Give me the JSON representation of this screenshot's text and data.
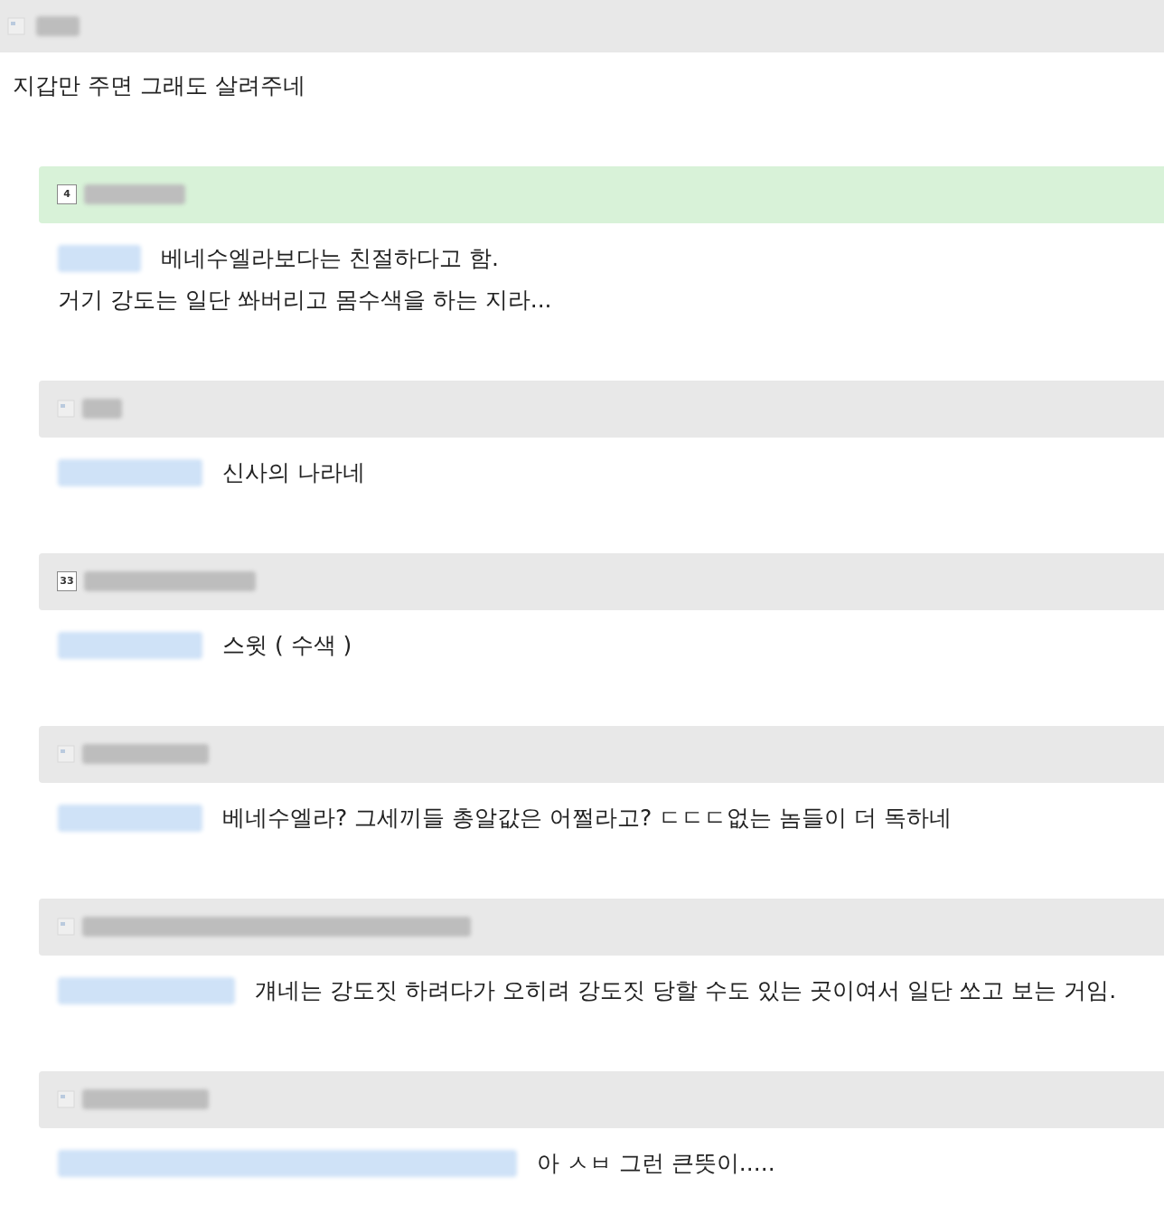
{
  "post": {
    "body": "지갑만 주면 그래도 살려주네"
  },
  "comments": [
    {
      "highlighted": true,
      "badge": "4",
      "reply": [
        "베네수엘라보다는 친절하다고 함.",
        "거기 강도는 일단 쏴버리고 몸수색을 하는 지라..."
      ]
    },
    {
      "highlighted": false,
      "reply": [
        "신사의 나라네"
      ]
    },
    {
      "highlighted": false,
      "badge": "33",
      "reply": [
        "스윗 ( 수색 )"
      ]
    },
    {
      "highlighted": false,
      "reply": [
        "베네수엘라? 그세끼들 총알값은 어쩔라고? ㄷㄷㄷ없는 놈들이 더 독하네"
      ]
    },
    {
      "highlighted": false,
      "reply": [
        "걔네는 강도짓 하려다가 오히려 강도짓 당할 수도 있는 곳이여서 일단 쏘고 보는 거임."
      ]
    },
    {
      "highlighted": false,
      "reply": [
        "아 ㅅㅂ 그런 큰뜻이....."
      ]
    }
  ]
}
